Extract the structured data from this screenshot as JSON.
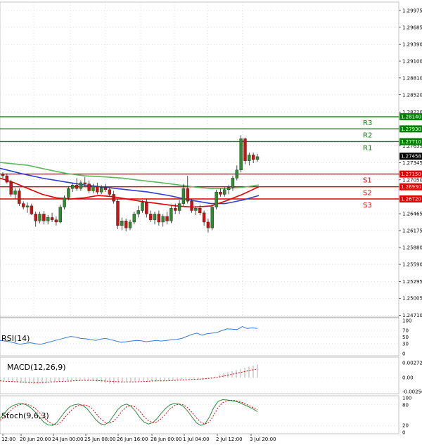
{
  "chart_data": [
    {
      "type": "candlestick",
      "ylim": [
        1.2468,
        1.3012
      ],
      "ticks": [
        "1.29975",
        "1.29685",
        "1.29390",
        "1.29100",
        "1.28810",
        "1.28520",
        "1.28220",
        "1.27635",
        "1.27345",
        "1.27050",
        "1.26465",
        "1.26175",
        "1.25880",
        "1.25590",
        "1.25295",
        "1.25005",
        "1.24710"
      ],
      "tick_values": [
        1.29975,
        1.29685,
        1.2939,
        1.291,
        1.2881,
        1.2852,
        1.2822,
        1.27635,
        1.27345,
        1.2705,
        1.26465,
        1.26175,
        1.2588,
        1.2559,
        1.25295,
        1.25005,
        1.2471
      ],
      "x_labels": [
        "12:00",
        "20 Jun 20:00",
        "24 Jun 00:00",
        "25 Jun 08:00",
        "26 Jun 16:00",
        "28 Jun 00:00",
        "1 Jul 04:00",
        "2 Jul 12:00",
        "3 Jul 20:00"
      ],
      "current_price": "1.27458",
      "current_value": 1.27458,
      "levels": [
        {
          "name": "R3",
          "value": 1.2814,
          "label": "1.28140",
          "color": "#008000"
        },
        {
          "name": "R2",
          "value": 1.2793,
          "label": "1.27930",
          "color": "#008000"
        },
        {
          "name": "R1",
          "value": 1.2771,
          "label": "1.27710",
          "color": "#008000"
        },
        {
          "name": "S1",
          "value": 1.2715,
          "label": "1.27150",
          "color": "#e00000"
        },
        {
          "name": "S2",
          "value": 1.2693,
          "label": "1.26930",
          "color": "#e00000"
        },
        {
          "name": "S3",
          "value": 1.2672,
          "label": "1.26720",
          "color": "#e00000"
        }
      ],
      "candles": [
        [
          1.2714,
          1.2718,
          1.2708,
          1.2712
        ],
        [
          1.2712,
          1.2716,
          1.2699,
          1.2701
        ],
        [
          1.2701,
          1.2705,
          1.2676,
          1.268
        ],
        [
          1.268,
          1.269,
          1.2672,
          1.2686
        ],
        [
          1.2686,
          1.269,
          1.266,
          1.2664
        ],
        [
          1.2664,
          1.2668,
          1.2654,
          1.2658
        ],
        [
          1.2658,
          1.2666,
          1.2648,
          1.266
        ],
        [
          1.266,
          1.2664,
          1.2644,
          1.2646
        ],
        [
          1.2646,
          1.265,
          1.2624,
          1.2634
        ],
        [
          1.2634,
          1.265,
          1.263,
          1.2646
        ],
        [
          1.2646,
          1.2651,
          1.2628,
          1.2634
        ],
        [
          1.2634,
          1.2644,
          1.2628,
          1.264
        ],
        [
          1.264,
          1.2648,
          1.2632,
          1.2636
        ],
        [
          1.2636,
          1.2642,
          1.2626,
          1.2632
        ],
        [
          1.2632,
          1.2662,
          1.263,
          1.2658
        ],
        [
          1.2658,
          1.2678,
          1.2654,
          1.2674
        ],
        [
          1.2674,
          1.2694,
          1.267,
          1.269
        ],
        [
          1.269,
          1.27,
          1.2684,
          1.2696
        ],
        [
          1.2696,
          1.2708,
          1.2686,
          1.269
        ],
        [
          1.269,
          1.2704,
          1.2686,
          1.27
        ],
        [
          1.27,
          1.271,
          1.2694,
          1.2698
        ],
        [
          1.2698,
          1.2704,
          1.2682,
          1.2686
        ],
        [
          1.2686,
          1.2698,
          1.2682,
          1.2694
        ],
        [
          1.2694,
          1.27,
          1.268,
          1.2684
        ],
        [
          1.2684,
          1.2696,
          1.268,
          1.2692
        ],
        [
          1.2692,
          1.2698,
          1.2684,
          1.2688
        ],
        [
          1.2688,
          1.2692,
          1.2676,
          1.268
        ],
        [
          1.268,
          1.2686,
          1.2664,
          1.2668
        ],
        [
          1.2668,
          1.2672,
          1.262,
          1.2626
        ],
        [
          1.2626,
          1.264,
          1.2618,
          1.2634
        ],
        [
          1.2634,
          1.2638,
          1.2616,
          1.2622
        ],
        [
          1.2622,
          1.2636,
          1.2618,
          1.2632
        ],
        [
          1.2632,
          1.265,
          1.2628,
          1.2646
        ],
        [
          1.2646,
          1.266,
          1.264,
          1.2652
        ],
        [
          1.2652,
          1.267,
          1.2648,
          1.2666
        ],
        [
          1.2666,
          1.2672,
          1.264,
          1.2646
        ],
        [
          1.2646,
          1.2652,
          1.2632,
          1.2636
        ],
        [
          1.2636,
          1.265,
          1.2628,
          1.2646
        ],
        [
          1.2646,
          1.2652,
          1.2626,
          1.2632
        ],
        [
          1.2632,
          1.2646,
          1.2624,
          1.2642
        ],
        [
          1.2642,
          1.265,
          1.2628,
          1.2634
        ],
        [
          1.2634,
          1.266,
          1.263,
          1.2656
        ],
        [
          1.2656,
          1.2664,
          1.2646,
          1.2652
        ],
        [
          1.2652,
          1.267,
          1.2646,
          1.2664
        ],
        [
          1.2664,
          1.2698,
          1.266,
          1.269
        ],
        [
          1.269,
          1.2712,
          1.2664,
          1.2668
        ],
        [
          1.2668,
          1.2672,
          1.2648,
          1.2652
        ],
        [
          1.2652,
          1.266,
          1.2644,
          1.2656
        ],
        [
          1.2656,
          1.2662,
          1.2644,
          1.2648
        ],
        [
          1.2648,
          1.2652,
          1.2626,
          1.2632
        ],
        [
          1.2632,
          1.2638,
          1.2614,
          1.2622
        ],
        [
          1.2622,
          1.266,
          1.2618,
          1.2658
        ],
        [
          1.2658,
          1.2688,
          1.2654,
          1.2684
        ],
        [
          1.2684,
          1.269,
          1.2676,
          1.268
        ],
        [
          1.268,
          1.2692,
          1.2676,
          1.2688
        ],
        [
          1.2688,
          1.2696,
          1.268,
          1.2692
        ],
        [
          1.2692,
          1.2712,
          1.2686,
          1.2708
        ],
        [
          1.2708,
          1.273,
          1.2704,
          1.2722
        ],
        [
          1.2722,
          1.2782,
          1.2718,
          1.2776
        ],
        [
          1.2776,
          1.2778,
          1.2732,
          1.2738
        ],
        [
          1.2738,
          1.2752,
          1.273,
          1.2748
        ],
        [
          1.2748,
          1.2752,
          1.2734,
          1.274
        ],
        [
          1.274,
          1.275,
          1.2736,
          1.2745
        ]
      ],
      "moving_averages": [
        {
          "color": "#5cb85c",
          "values": [
            [
              0,
              1.2735
            ],
            [
              40,
              1.273
            ],
            [
              70,
              1.2722
            ],
            [
              95,
              1.2716
            ],
            [
              120,
              1.2712
            ],
            [
              150,
              1.271
            ],
            [
              175,
              1.2708
            ],
            [
              200,
              1.2704
            ],
            [
              230,
              1.27
            ],
            [
              255,
              1.2696
            ],
            [
              280,
              1.2692
            ],
            [
              300,
              1.269
            ],
            [
              320,
              1.269
            ],
            [
              345,
              1.2692
            ],
            [
              368,
              1.2696
            ]
          ]
        },
        {
          "color": "#2f3fd0",
          "values": [
            [
              0,
              1.2725
            ],
            [
              30,
              1.2716
            ],
            [
              60,
              1.2708
            ],
            [
              90,
              1.2702
            ],
            [
              120,
              1.2696
            ],
            [
              150,
              1.2692
            ],
            [
              180,
              1.2688
            ],
            [
              210,
              1.2684
            ],
            [
              240,
              1.2678
            ],
            [
              270,
              1.267
            ],
            [
              300,
              1.2664
            ],
            [
              320,
              1.2664
            ],
            [
              345,
              1.267
            ],
            [
              368,
              1.2678
            ]
          ]
        },
        {
          "color": "#e00000",
          "values": [
            [
              0,
              1.2708
            ],
            [
              20,
              1.27
            ],
            [
              40,
              1.269
            ],
            [
              60,
              1.268
            ],
            [
              80,
              1.2674
            ],
            [
              100,
              1.2672
            ],
            [
              120,
              1.2674
            ],
            [
              140,
              1.2678
            ],
            [
              160,
              1.2676
            ],
            [
              180,
              1.2672
            ],
            [
              200,
              1.2668
            ],
            [
              225,
              1.2664
            ],
            [
              250,
              1.266
            ],
            [
              275,
              1.2658
            ],
            [
              300,
              1.266
            ],
            [
              320,
              1.2668
            ],
            [
              345,
              1.268
            ],
            [
              368,
              1.2693
            ]
          ]
        }
      ]
    },
    {
      "type": "line",
      "label": "RSI(14)",
      "ylim": [
        0,
        100
      ],
      "tick_labels": [
        "100",
        "70",
        "50",
        "30",
        "0"
      ],
      "tick_values": [
        100,
        70,
        50,
        30,
        0
      ],
      "values": [
        40,
        38,
        36,
        32,
        28,
        31,
        33,
        30,
        28,
        32,
        36,
        40,
        44,
        48,
        52,
        50,
        46,
        45,
        42,
        40,
        44,
        46,
        42,
        38,
        34,
        36,
        38,
        40,
        39,
        36,
        38,
        40,
        38,
        40,
        42,
        43,
        46,
        52,
        58,
        62,
        56,
        60,
        62,
        64,
        70,
        75,
        74,
        73,
        82,
        76,
        78,
        76
      ]
    },
    {
      "type": "bar",
      "label": "MACD(12,26,9)",
      "ylim": [
        -0.002565,
        0.002727
      ],
      "tick_labels": [
        "0.002727",
        "0.00",
        "-0.002565"
      ],
      "tick_values": [
        0.002727,
        0,
        -0.002565
      ],
      "values": [
        -0.0004,
        -0.0005,
        -0.0006,
        -0.0008,
        -0.0009,
        -0.001,
        -0.001,
        -0.0011,
        -0.0012,
        -0.0012,
        -0.0011,
        -0.001,
        -0.0009,
        -0.0008,
        -0.0007,
        -0.0006,
        -0.0005,
        -0.0005,
        -0.0004,
        -0.0004,
        -0.0004,
        -0.0005,
        -0.0006,
        -0.0008,
        -0.0009,
        -0.001,
        -0.0011,
        -0.0011,
        -0.001,
        -0.0009,
        -0.0008,
        -0.0008,
        -0.0007,
        -0.0007,
        -0.0006,
        -0.0006,
        -0.0006,
        -0.0007,
        -0.0007,
        -0.0006,
        -0.0006,
        -0.0005,
        -0.0004,
        -0.0003,
        -0.0002,
        -0.0002,
        -0.0003,
        -0.0004,
        -0.0004,
        -0.0003,
        -0.0001,
        0.0002,
        0.0005,
        0.0008,
        0.001,
        0.0012,
        0.0014,
        0.0016,
        0.0018,
        0.002,
        0.0022,
        0.0024
      ],
      "signal": [
        -0.0006,
        -0.0007,
        -0.0008,
        -0.0009,
        -0.0009,
        -0.0008,
        -0.0007,
        -0.0006,
        -0.0005,
        -0.0005,
        -0.0006,
        -0.0007,
        -0.0008,
        -0.0008,
        -0.0007,
        -0.0006,
        -0.0006,
        -0.0005,
        -0.0004,
        -0.0003,
        -0.0002,
        0.0,
        0.0004,
        0.0008,
        0.0012,
        0.0016
      ]
    },
    {
      "type": "line",
      "label": "Stoch(9,6,3)",
      "ylim": [
        0,
        100
      ],
      "tick_labels": [
        "100",
        "80",
        "20",
        "0"
      ],
      "tick_values": [
        100,
        80,
        20,
        0
      ],
      "main": [
        40,
        55,
        70,
        78,
        82,
        84,
        80,
        72,
        60,
        45,
        30,
        22,
        20,
        28,
        45,
        62,
        75,
        80,
        82,
        78,
        68,
        52,
        36,
        25,
        22,
        30,
        48,
        66,
        78,
        82,
        76,
        62,
        44,
        30,
        24,
        28,
        40,
        56,
        70,
        80,
        84,
        82,
        76,
        62,
        45,
        28,
        20,
        25,
        45,
        72,
        90,
        95,
        94,
        92,
        90,
        86,
        80,
        74,
        68,
        60
      ],
      "signal": [
        35,
        45,
        58,
        70,
        78,
        82,
        82,
        78,
        70,
        58,
        44,
        32,
        24,
        22,
        30,
        45,
        60,
        72,
        78,
        80,
        78,
        70,
        55,
        40,
        30,
        26,
        32,
        46,
        62,
        74,
        78,
        74,
        62,
        46,
        34,
        28,
        30,
        40,
        54,
        68,
        78,
        82,
        80,
        72,
        58,
        42,
        30,
        24,
        30,
        50,
        72,
        86,
        92,
        93,
        92,
        89,
        84,
        78,
        72,
        66
      ]
    }
  ]
}
